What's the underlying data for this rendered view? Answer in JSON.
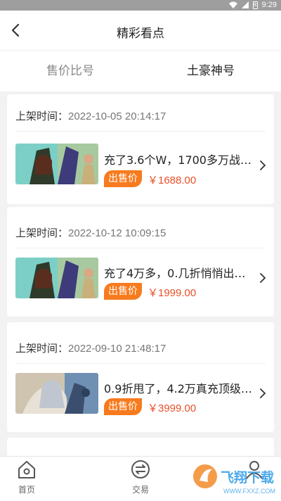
{
  "status": {
    "time": "9:29",
    "battery": "8"
  },
  "header": {
    "title": "精彩看点"
  },
  "tabs": [
    {
      "label": "售价比号",
      "active": false
    },
    {
      "label": "土豪神号",
      "active": true
    }
  ],
  "items": [
    {
      "time_label": "上架时间：",
      "time": "2022-10-05 20:14:17",
      "title": "充了3.6个W，1700多万战…",
      "badge": "出售价",
      "price": "￥1688.00",
      "thumb": "hero-warrior-art"
    },
    {
      "time_label": "上架时间：",
      "time": "2022-10-12 10:09:15",
      "title": "充了4万多，0.几折悄悄出…",
      "badge": "出售价",
      "price": "￥1999.00",
      "thumb": "hero-warrior-art"
    },
    {
      "time_label": "上架时间：",
      "time": "2022-09-10 21:48:17",
      "title": "0.9折甩了，4.2万真充顶级…",
      "badge": "出售价",
      "price": "￥3999.00",
      "thumb": "hero-sage-art"
    }
  ],
  "nav": [
    {
      "label": "首页",
      "icon": "home-icon"
    },
    {
      "label": "交易",
      "icon": "trade-icon"
    },
    {
      "label": "",
      "icon": "user-icon"
    }
  ],
  "watermark": {
    "text": "飞翔下载",
    "subtext": "WWW.FXXZ.COM"
  },
  "colors": {
    "accent": "#f77b1e",
    "price": "#e8502a",
    "background": "#f2f2f2"
  }
}
